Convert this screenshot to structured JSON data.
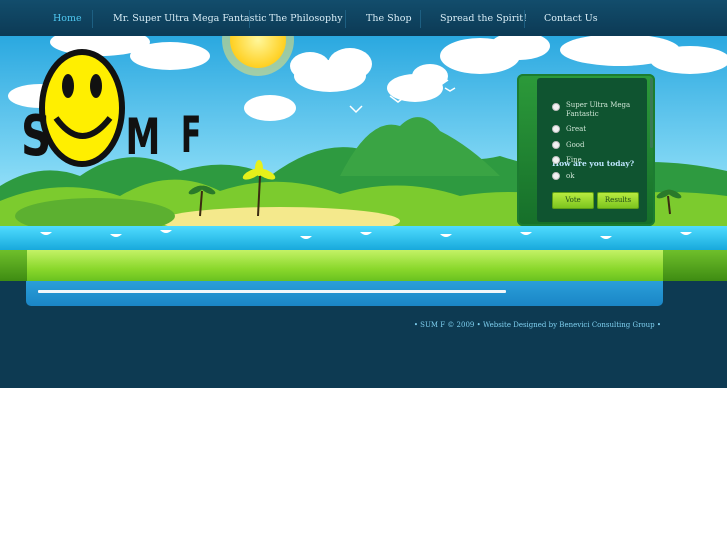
{
  "nav": {
    "items": [
      {
        "label": "Home",
        "active": true
      },
      {
        "label": "Mr. Super Ultra Mega Fantastic",
        "active": false
      },
      {
        "label": "The Philosophy",
        "active": false
      },
      {
        "label": "The Shop",
        "active": false
      },
      {
        "label": "Spread the Spirit!",
        "active": false
      },
      {
        "label": "Contact Us",
        "active": false
      }
    ]
  },
  "logo": {
    "letters": [
      "S",
      "M",
      "F"
    ]
  },
  "poll": {
    "question": "How are you today?",
    "options": [
      "Super Ultra Mega Fantastic",
      "Great",
      "Good",
      "Fine",
      "ok"
    ],
    "vote_label": "Vote",
    "results_label": "Results"
  },
  "footer": {
    "text": "• SUM F © 2009 • Website Designed by Benevici Consulting Group •"
  },
  "colors": {
    "nav_bg": "#0c3a55",
    "accent": "#4fc7f0",
    "poll_green": "#2c9a3a",
    "button_green": "#9bdc2f",
    "sky": "#5cc8ee",
    "sea": "#2fd0f0",
    "footer_bg": "#0d3a52"
  }
}
